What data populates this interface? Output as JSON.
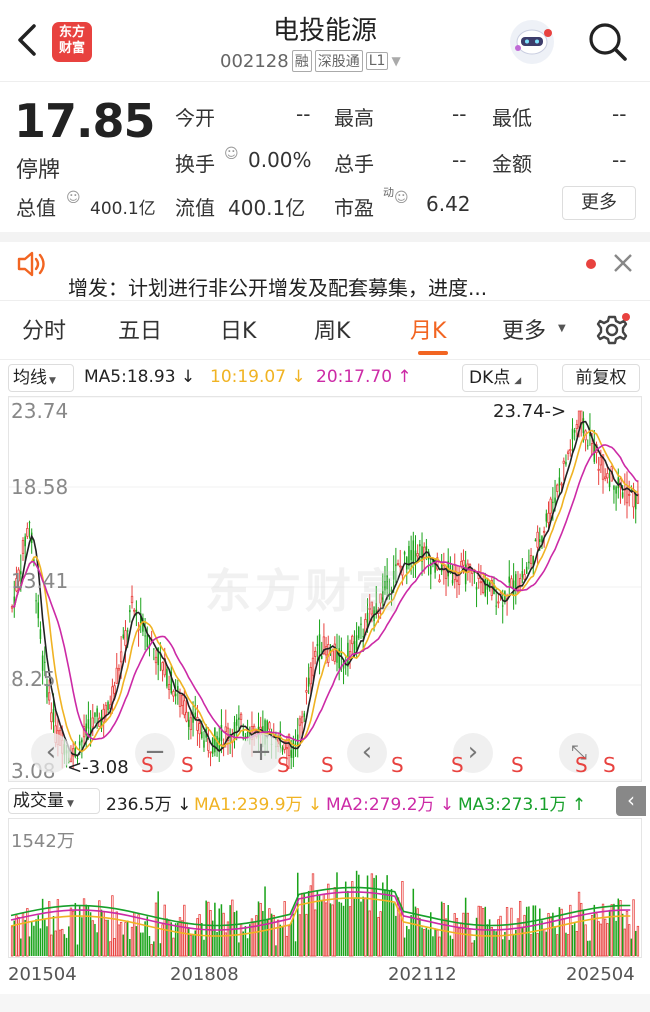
{
  "header": {
    "title": "电投能源",
    "code": "002128",
    "tags": [
      "融",
      "深股通",
      "L1"
    ],
    "logo_line1": "东方",
    "logo_line2": "财富"
  },
  "quote": {
    "price": "17.85",
    "status": "停牌",
    "open_label": "今开",
    "open_value": "--",
    "high_label": "最高",
    "high_value": "--",
    "low_label": "最低",
    "low_value": "--",
    "turnover_label": "换手",
    "turnover_value": "0.00%",
    "volume_label": "总手",
    "volume_value": "--",
    "amount_label": "金额",
    "amount_value": "--",
    "mktcap_label": "总值",
    "mktcap_value": "400.1亿",
    "float_label": "流值",
    "float_value": "400.1亿",
    "pe_label": "市盈",
    "pe_sup": "动",
    "pe_value": "6.42",
    "more_label": "更多"
  },
  "news": {
    "text": "增发：计划进行非公开增发及配套募集，进度..."
  },
  "tabs": {
    "items": [
      "分时",
      "五日",
      "日K",
      "周K",
      "月K",
      "更多"
    ],
    "active_index": 4
  },
  "ma_bar": {
    "selector": "均线",
    "ma5": "MA5:18.93 ↓",
    "ma10": "10:19.07 ↓",
    "ma20": "20:17.70 ↑",
    "dk_label": "DK点",
    "adjust_label": "前复权"
  },
  "price_axis": {
    "labels": [
      "23.74",
      "18.58",
      "13.41",
      "8.25",
      "3.08"
    ],
    "max_marker": "23.74->",
    "min_marker": "<-3.08",
    "watermark": "东方财富"
  },
  "markers": {
    "s_label": "S",
    "s_count": 11,
    "minus": "−",
    "plus": "+",
    "prev": "‹",
    "next": "›"
  },
  "vol_bar": {
    "selector": "成交量",
    "value": "236.5万 ↓",
    "ma1": "MA1:239.9万 ↓",
    "ma2": "MA2:279.2万 ↓",
    "ma3": "MA3:273.1万 ↑",
    "axis_max": "1542万"
  },
  "time_axis": [
    "201504",
    "201808",
    "202112",
    "202504"
  ],
  "colors": {
    "up": "#e8423f",
    "down": "#1aa31a",
    "accent": "#f26522",
    "ma5": "#222222",
    "ma10": "#f0b323",
    "ma20": "#cc2aa6",
    "ma3": "#17a02a"
  }
}
